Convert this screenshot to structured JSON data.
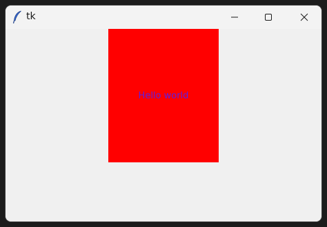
{
  "window": {
    "title": "tk",
    "icon": "tk-feather-icon",
    "controls": {
      "minimize_icon": "minimize-icon",
      "maximize_icon": "maximize-icon",
      "close_icon": "close-icon"
    }
  },
  "content": {
    "label_text": "Hello world",
    "label_background": "#ff0000",
    "label_foreground": "#5a1ee6",
    "window_background": "#f0f0f0"
  }
}
